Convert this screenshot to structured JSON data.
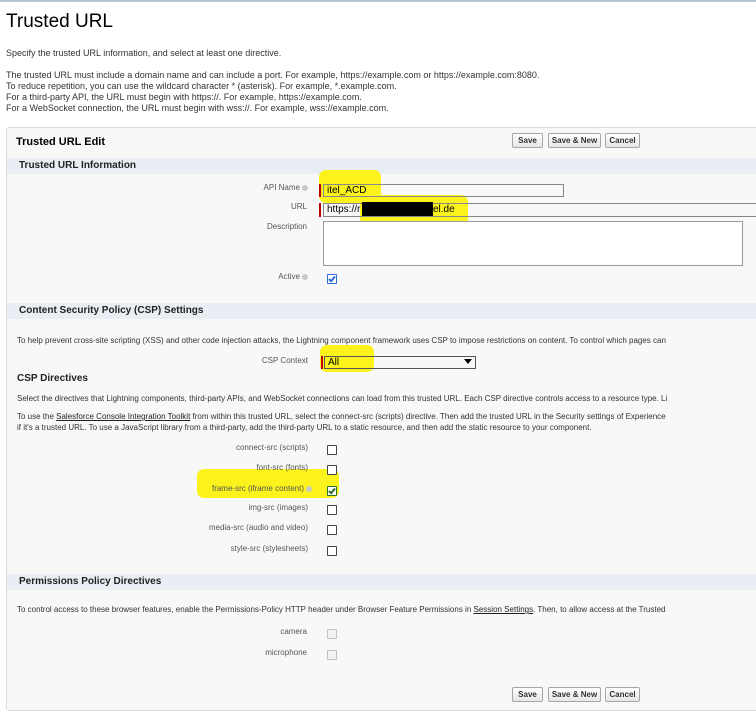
{
  "page": {
    "title": "Trusted URL",
    "intro": "Specify the trusted URL information, and select at least one directive.",
    "info_lines": [
      "The trusted URL must include a domain name and can include a port. For example, https://example.com or https://example.com:8080.",
      "To reduce repetition, you can use the wildcard character * (asterisk). For example, *.example.com.",
      "For a third-party API, the URL must begin with https://. For example, https://example.com.",
      "For a WebSocket connection, the URL must begin with wss://. For example, wss://example.com."
    ]
  },
  "edit": {
    "title": "Trusted URL Edit",
    "save_label": "Save",
    "save_new_label": "Save & New",
    "cancel_label": "Cancel"
  },
  "info_section": {
    "header": "Trusted URL Information",
    "api_name_label": "API Name",
    "api_name_value": "itel_ACD",
    "url_label": "URL",
    "url_prefix": "https://r",
    "url_suffix": "el.de",
    "description_label": "Description",
    "active_label": "Active",
    "active": true
  },
  "csp_section": {
    "header": "Content Security Policy (CSP) Settings",
    "intro": "To help prevent cross-site scripting (XSS) and other code injection attacks, the Lightning component framework uses CSP to impose restrictions on content. To control which pages can",
    "context_label": "CSP Context",
    "context_value": "All",
    "directives_title": "CSP Directives",
    "directives_text": "Select the directives that Lightning components, third-party APIs, and WebSocket connections can load from this trusted URL. Each CSP directive controls access to a resource type. Li",
    "toolkit_before": "To use the ",
    "toolkit_link": "Salesforce Console Integration Toolkit",
    "toolkit_after": " from within this trusted URL, select the connect-src (scripts) directive. Then add the trusted URL in the Security settings of Experience",
    "toolkit_line2": "if it's a trusted URL. To use a JavaScript library from a third-party, add the third-party URL to a static resource, and then add the static resource to your component.",
    "directives": [
      {
        "label": "connect-src (scripts)",
        "checked": false
      },
      {
        "label": "font-src (fonts)",
        "checked": false
      },
      {
        "label": "frame-src (iframe content)",
        "checked": true
      },
      {
        "label": "img-src (images)",
        "checked": false
      },
      {
        "label": "media-src (audio and video)",
        "checked": false
      },
      {
        "label": "style-src (stylesheets)",
        "checked": false
      }
    ]
  },
  "permissions_section": {
    "header": "Permissions Policy Directives",
    "intro_before": "To control access to these browser features, enable the Permissions-Policy HTTP header under Browser Feature Permissions in ",
    "intro_link": "Session Settings",
    "intro_after": ". Then, to allow access at the Trusted",
    "camera_label": "camera",
    "microphone_label": "microphone"
  },
  "colors": {
    "highlight": "#fbf31b",
    "section_header": "#e9eef4",
    "required_bar": "#c00000",
    "checkbox_blue": "#2f6bd6",
    "checkbox_green": "#2a6e2a"
  }
}
